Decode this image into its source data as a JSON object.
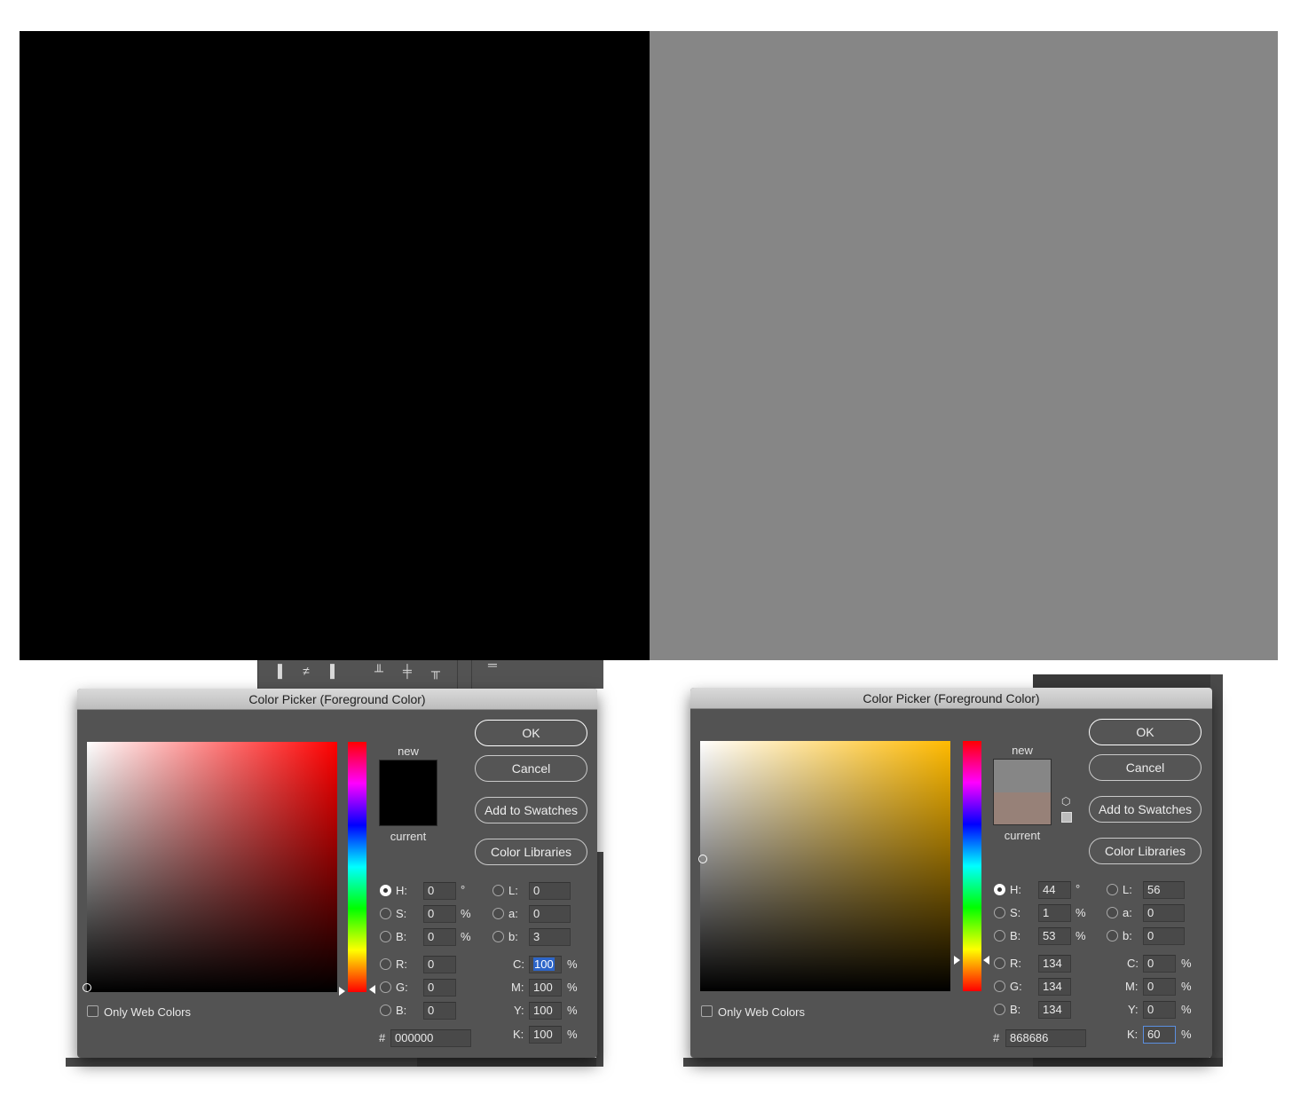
{
  "swatches": {
    "left_color": "#000000",
    "right_color": "#868686"
  },
  "dialogs": [
    {
      "title": "Color Picker (Foreground Color)",
      "hue_color": "#ff0000",
      "new_color": "#000000",
      "current_color": "#000000",
      "labels": {
        "new": "new",
        "current": "current"
      },
      "buttons": {
        "ok": "OK",
        "cancel": "Cancel",
        "add": "Add to Swatches",
        "libraries": "Color Libraries"
      },
      "hsb": {
        "h": "0",
        "s": "0",
        "b": "0"
      },
      "lab": {
        "l": "0",
        "a": "0",
        "b": "3"
      },
      "rgb": {
        "r": "0",
        "g": "0",
        "b": "0"
      },
      "cmyk": {
        "c": "100",
        "m": "100",
        "y": "100",
        "k": "100"
      },
      "hex": "000000",
      "only_web": "Only Web Colors"
    },
    {
      "title": "Color Picker (Foreground Color)",
      "hue_color": "#ffba00",
      "new_color": "#868686",
      "current_color": "#978178",
      "labels": {
        "new": "new",
        "current": "current"
      },
      "buttons": {
        "ok": "OK",
        "cancel": "Cancel",
        "add": "Add to Swatches",
        "libraries": "Color Libraries"
      },
      "hsb": {
        "h": "44",
        "s": "1",
        "b": "53"
      },
      "lab": {
        "l": "56",
        "a": "0",
        "b": "0"
      },
      "rgb": {
        "r": "134",
        "g": "134",
        "b": "134"
      },
      "cmyk": {
        "c": "0",
        "m": "0",
        "y": "0",
        "k": "60"
      },
      "hex": "868686",
      "only_web": "Only Web Colors"
    }
  ],
  "field_labels": {
    "h": "H:",
    "s": "S:",
    "b": "B:",
    "l": "L:",
    "a": "a:",
    "lb": "b:",
    "r": "R:",
    "g": "G:",
    "bb": "B:",
    "c": "C:",
    "m": "M:",
    "y": "Y:",
    "k": "K:",
    "hash": "#"
  },
  "units": {
    "deg": "°",
    "pct": "%"
  }
}
